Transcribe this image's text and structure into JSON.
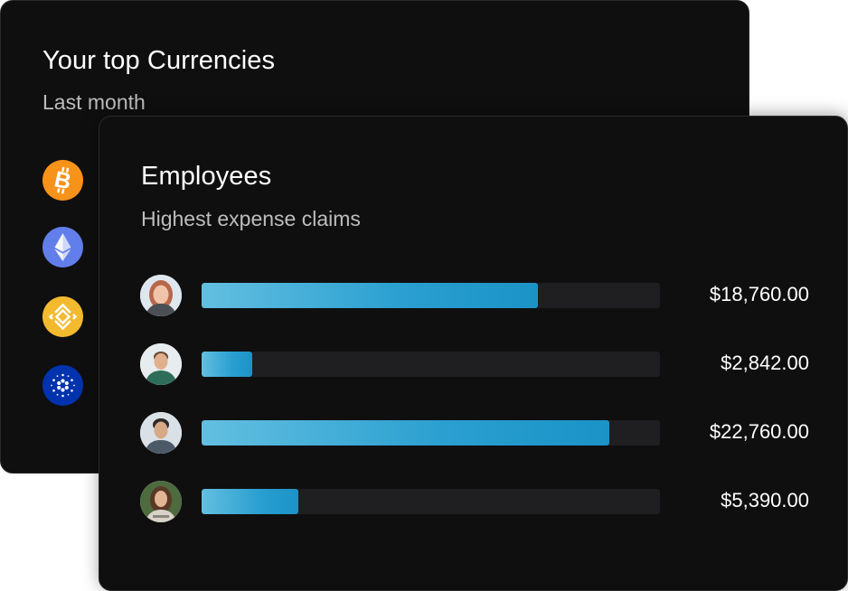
{
  "currencies_card": {
    "title": "Your top Currencies",
    "subtitle": "Last month",
    "coins": [
      {
        "icon": "bitcoin-icon",
        "color": "#f7931a"
      },
      {
        "icon": "ethereum-icon",
        "color": "#627eea"
      },
      {
        "icon": "bnb-icon",
        "color": "#f3ba2f"
      },
      {
        "icon": "cardano-icon",
        "color": "#0033ad"
      }
    ]
  },
  "employees_card": {
    "title": "Employees",
    "subtitle": "Highest expense claims",
    "bar_max": 25600,
    "employees": [
      {
        "avatar": "employee-avatar-1",
        "amount_label": "$18,760.00",
        "amount": 18760
      },
      {
        "avatar": "employee-avatar-2",
        "amount_label": "$2,842.00",
        "amount": 2842
      },
      {
        "avatar": "employee-avatar-3",
        "amount_label": "$22,760.00",
        "amount": 22760
      },
      {
        "avatar": "employee-avatar-4",
        "amount_label": "$5,390.00",
        "amount": 5390
      }
    ]
  }
}
